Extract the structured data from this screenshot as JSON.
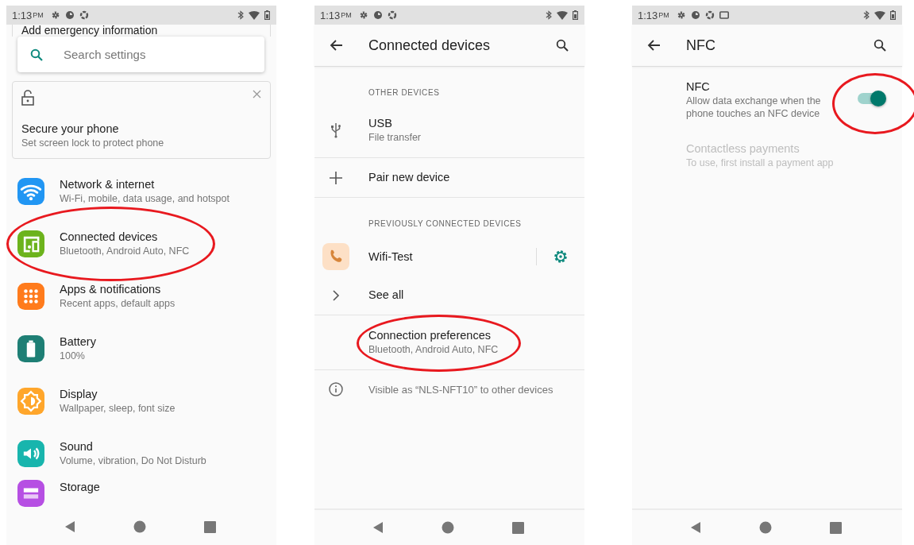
{
  "screens": [
    {
      "kind": "home",
      "status_bar": {
        "time": "1:13",
        "meridiem": "PM",
        "notification_icons": [
          {
            "kind": "gear"
          },
          {
            "kind": "pie"
          },
          {
            "kind": "ring"
          }
        ]
      },
      "emergency_card": {
        "title": "Add emergency information"
      },
      "search": {
        "placeholder": "Search settings"
      },
      "suggestion": {
        "title": "Secure your phone",
        "summary": "Set screen lock to protect phone"
      },
      "categories": [
        {
          "kind": "wifi",
          "color": "#2196f3",
          "title": "Network & internet",
          "summary": "Wi-Fi, mobile, data usage, and hotspot",
          "highlighted": false
        },
        {
          "kind": "devices",
          "color": "#6cb31c",
          "title": "Connected devices",
          "summary": "Bluetooth, Android Auto, NFC",
          "highlighted": true
        },
        {
          "kind": "apps",
          "color": "#ff7b1c",
          "title": "Apps & notifications",
          "summary": "Recent apps, default apps",
          "highlighted": false
        },
        {
          "kind": "battery",
          "color": "#1e7f75",
          "title": "Battery",
          "summary": "100%",
          "highlighted": false
        },
        {
          "kind": "display",
          "color": "#ffa62b",
          "title": "Display",
          "summary": "Wallpaper, sleep, font size",
          "highlighted": false
        },
        {
          "kind": "sound",
          "color": "#18b5ad",
          "title": "Sound",
          "summary": "Volume, vibration, Do Not Disturb",
          "highlighted": false
        },
        {
          "kind": "storage",
          "color": "#b64fe3",
          "title": "Storage",
          "highlighted": false
        }
      ]
    },
    {
      "kind": "list",
      "status_bar": {
        "time": "1:13",
        "meridiem": "PM",
        "notification_icons": [
          {
            "kind": "gear"
          },
          {
            "kind": "pie"
          },
          {
            "kind": "ring"
          }
        ]
      },
      "app_bar": {
        "title": "Connected devices"
      },
      "items": [
        {
          "kind": "header",
          "title": "OTHER DEVICES"
        },
        {
          "kind": "usb",
          "title": "USB",
          "summary": "File transfer",
          "highlighted": false
        },
        {
          "kind": "divider"
        },
        {
          "kind": "add",
          "title": "Pair new device",
          "highlighted": false
        },
        {
          "kind": "divider"
        },
        {
          "kind": "header",
          "title": "PREVIOUSLY CONNECTED DEVICES"
        },
        {
          "kind": "device",
          "title": "Wifi-Test"
        },
        {
          "kind": "more",
          "title": "See all",
          "highlighted": false
        },
        {
          "kind": "divider"
        },
        {
          "kind": "preference",
          "title": "Connection preferences",
          "summary": "Bluetooth, Android Auto, NFC",
          "disabled": false,
          "highlighted": true
        },
        {
          "kind": "divider"
        },
        {
          "kind": "footer",
          "title": "Visible as “NLS-NFT10” to other devices"
        }
      ]
    },
    {
      "kind": "list",
      "status_bar": {
        "time": "1:13",
        "meridiem": "PM",
        "notification_icons": [
          {
            "kind": "gear"
          },
          {
            "kind": "pie"
          },
          {
            "kind": "ring"
          },
          {
            "kind": "screen"
          }
        ]
      },
      "app_bar": {
        "title": "NFC"
      },
      "items": [
        {
          "kind": "switch",
          "title": "NFC",
          "summary": "Allow data exchange when the phone touches an NFC device",
          "on": true,
          "highlighted": true
        },
        {
          "kind": "preference",
          "title": "Contactless payments",
          "summary": "To use, first install a payment app",
          "disabled": true,
          "highlighted": false
        }
      ]
    }
  ]
}
